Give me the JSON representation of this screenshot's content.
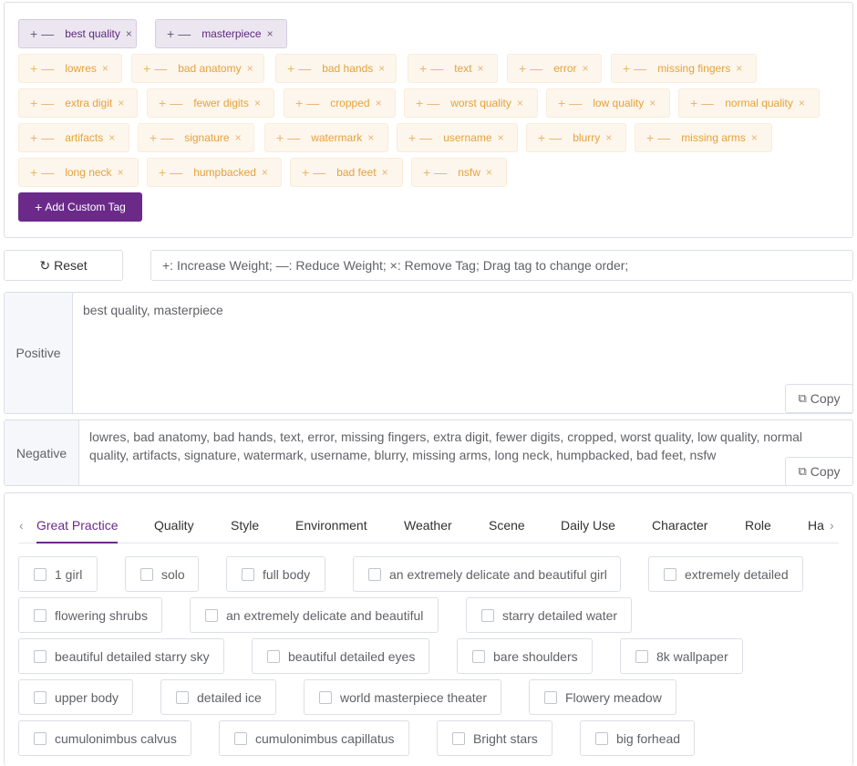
{
  "positive_tags": [
    "best quality",
    "masterpiece"
  ],
  "negative_tags": [
    "lowres",
    "bad anatomy",
    "bad hands",
    "text",
    "error",
    "missing fingers",
    "extra digit",
    "fewer digits",
    "cropped",
    "worst quality",
    "low quality",
    "normal quality",
    "artifacts",
    "signature",
    "watermark",
    "username",
    "blurry",
    "missing arms",
    "long neck",
    "humpbacked",
    "bad feet",
    "nsfw"
  ],
  "tag_controls": {
    "increase": "+",
    "decrease": "—",
    "remove": "×"
  },
  "add_tag_label": "Add Custom Tag",
  "reset_label": "Reset",
  "help_text": "+: Increase Weight; —: Reduce Weight; ×: Remove Tag; Drag tag to change order;",
  "positive": {
    "label": "Positive",
    "text": "best quality, masterpiece"
  },
  "negative": {
    "label": "Negative",
    "text": "lowres, bad anatomy, bad hands, text, error, missing fingers, extra digit, fewer digits, cropped, worst quality, low quality, normal quality, artifacts, signature, watermark, username, blurry, missing arms, long neck, humpbacked, bad feet, nsfw"
  },
  "copy_label": "Copy",
  "tabs": [
    "Great Practice",
    "Quality",
    "Style",
    "Environment",
    "Weather",
    "Scene",
    "Daily Use",
    "Character",
    "Role",
    "Ha"
  ],
  "active_tab": "Great Practice",
  "presets": [
    "1 girl",
    "solo",
    "full body",
    "an extremely delicate and beautiful girl",
    "extremely detailed",
    "flowering shrubs",
    "an extremely delicate and beautiful",
    "starry detailed water",
    "beautiful detailed starry sky",
    "beautiful detailed eyes",
    "bare shoulders",
    "8k wallpaper",
    "upper body",
    "detailed ice",
    "world masterpiece theater",
    "Flowery meadow",
    "cumulonimbus calvus",
    "cumulonimbus capillatus",
    "Bright stars",
    "big forhead"
  ],
  "icons": {
    "reset": "refresh-icon",
    "copy": "copy-icon",
    "add": "plus-icon",
    "prev": "chevron-left-icon",
    "next": "chevron-right-icon"
  },
  "colors": {
    "accent": "#6b2a8a",
    "positive_tag_bg": "#ece6f1",
    "negative_tag_bg": "#fdf6ec",
    "negative_tag_text": "#e6a23c"
  }
}
